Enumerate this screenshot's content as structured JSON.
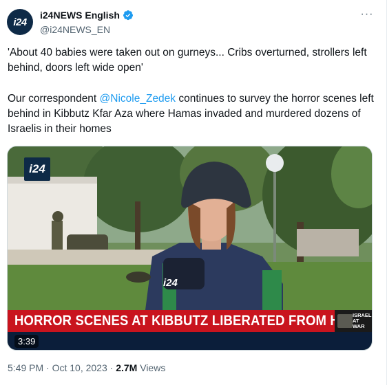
{
  "tweet": {
    "avatar_text": "i24",
    "display_name": "i24NEWS English",
    "handle": "@i24NEWS_EN",
    "more_icon": "more-icon",
    "quote": "'About 40 babies were taken out on gurneys... Cribs overturned, strollers left behind, doors left wide open'",
    "body_prefix": "Our correspondent ",
    "mention": "@Nicole_Zedek",
    "body_suffix": " continues to survey the horror scenes left behind in Kibbutz Kfar Aza where Hamas invaded and murdered dozens of Israelis in their homes"
  },
  "media": {
    "logo_text": "i24",
    "headline": "HORROR SCENES AT KIBBUTZ LIBERATED FROM HAMAS",
    "badge": "ISRAEL AT WAR",
    "duration": "3:39",
    "vest_text": "i24"
  },
  "meta": {
    "time": "5:49 PM",
    "separator": "·",
    "date": "Oct 10, 2023",
    "views_count": "2.7M",
    "views_label": "Views"
  },
  "colors": {
    "accent": "#1d9bf0",
    "banner_red": "#c9141e",
    "brand_navy": "#0e2a47"
  }
}
